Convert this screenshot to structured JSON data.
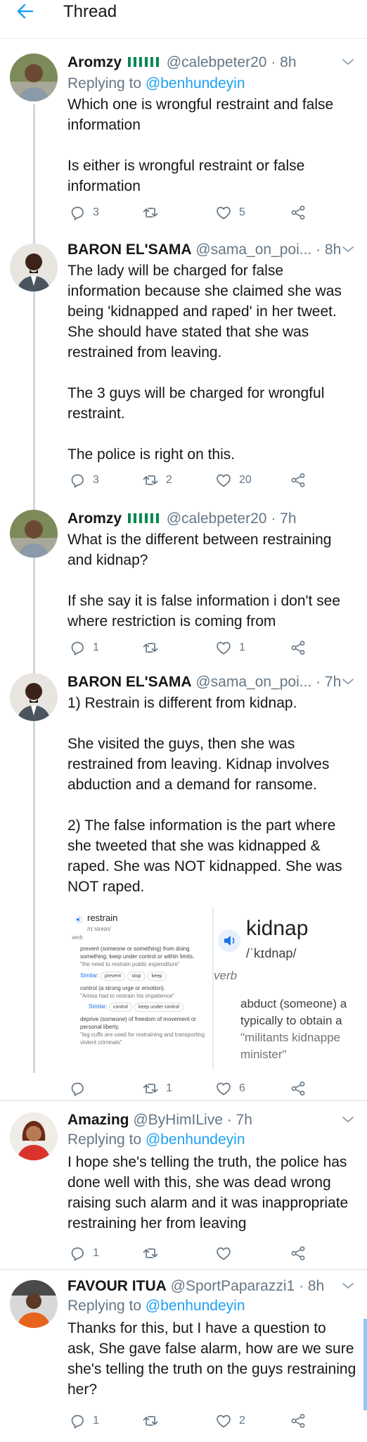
{
  "header": {
    "title": "Thread"
  },
  "tweets": [
    {
      "name": "Aromzy",
      "handle": "@calebpeter20",
      "time": "· 8h",
      "replying_prefix": "Replying to ",
      "replying_to": "@benhundeyin",
      "text": "Which one is wrongful restraint and false information\n\nIs either is wrongful restraint or false information",
      "replies": "3",
      "retweets": "",
      "likes": "5"
    },
    {
      "name": "BARON EL'SAMA",
      "handle": "@sama_on_poi...",
      "time": "· 8h",
      "text": "The lady will be charged for false information because she claimed she was being 'kidnapped and raped' in her tweet. She should have stated that she was restrained from leaving.\n\nThe 3 guys will be charged for wrongful restraint.\n\nThe police is right on this.",
      "replies": "3",
      "retweets": "2",
      "likes": "20"
    },
    {
      "name": "Aromzy",
      "handle": "@calebpeter20",
      "time": "· 7h",
      "text": "What is the different between restraining and kidnap?\n\nIf she say it is false information i don't see where restriction is coming from",
      "replies": "1",
      "retweets": "",
      "likes": "1"
    },
    {
      "name": "BARON EL'SAMA",
      "handle": "@sama_on_poi...",
      "time": "· 7h",
      "text": "1) Restrain is different from kidnap.\n\nShe visited the guys, then she was restrained from leaving. Kidnap involves abduction and a demand for ransome.\n\n2) The false information is the part where she tweeted that she was kidnapped & raped. She was NOT kidnapped. She was NOT raped.",
      "replies": "",
      "retweets": "1",
      "likes": "6",
      "media": {
        "left": {
          "word": "restrain",
          "phonetic": "/rɪˈstreɪn/",
          "pos": "verb",
          "def1": "prevent (someone or something) from doing something; keep under control or within limits.",
          "ex1": "\"the need to restrain public expenditure\"",
          "similar_label": "Similar:",
          "similar1": [
            "prevent",
            "stop",
            "keep"
          ],
          "def2": "control (a strong urge or emotion).",
          "ex2": "\"Amiss had to restrain his impatience\"",
          "similar2": [
            "control",
            "keep under control"
          ],
          "def3": "deprive (someone) of freedom of movement or personal liberty.",
          "ex3": "\"leg cuffs are used for restraining and transporting violent criminals\""
        },
        "right": {
          "word": "kidnap",
          "phonetic": "/ˈkɪdnap/",
          "pos": "verb",
          "line1": "abduct (someone) a",
          "line2": "typically to obtain a",
          "line3": "\"militants kidnappe",
          "line4": "minister\""
        }
      }
    },
    {
      "name": "Amazing",
      "handle": "@ByHimILive",
      "time": "· 7h",
      "replying_prefix": "Replying to ",
      "replying_to": "@benhundeyin",
      "text": "I hope she's telling the truth, the police has done well with this, she was dead wrong raising such alarm and it was inappropriate restraining her from leaving",
      "replies": "1",
      "retweets": "",
      "likes": ""
    },
    {
      "name": "FAVOUR ITUA",
      "handle": "@SportPaparazzi1",
      "time": "· 8h",
      "replying_prefix": "Replying to ",
      "replying_to": "@benhundeyin",
      "text": "Thanks for this, but I have a question to ask, She gave false alarm, how are we sure she's telling the truth on the guys restraining her?",
      "replies": "1",
      "retweets": "",
      "likes": "2"
    }
  ],
  "colors": {
    "accent": "#1da1f2",
    "muted": "#657786",
    "flag_green": "#008751"
  },
  "icons": [
    "back-arrow-icon",
    "chevron-down-icon",
    "reply-icon",
    "retweet-icon",
    "like-icon",
    "share-icon",
    "speaker-icon",
    "nigeria-flag-icon"
  ]
}
